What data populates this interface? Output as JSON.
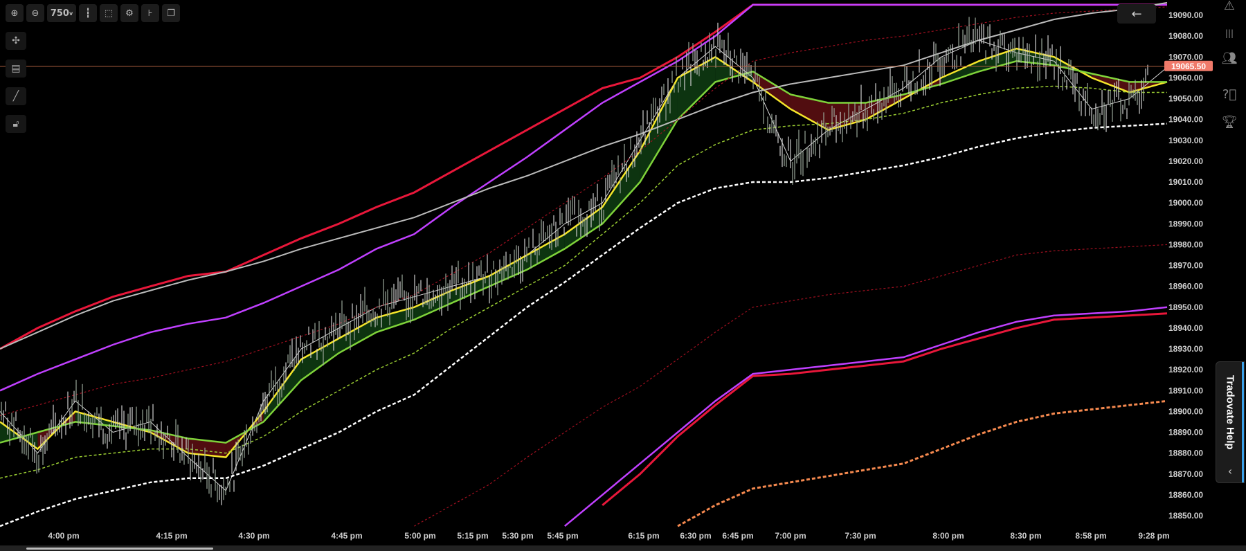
{
  "toolbar": {
    "zoom_in_icon": "zoom-in-icon",
    "zoom_out_icon": "zoom-out-icon",
    "bar_count_label": "750",
    "bar_count_suffix": "v"
  },
  "price_axis": {
    "labels": [
      "19090.00",
      "19080.00",
      "19070.00",
      "19060.00",
      "19050.00",
      "19040.00",
      "19030.00",
      "19020.00",
      "19010.00",
      "19000.00",
      "18990.00",
      "18980.00",
      "18970.00",
      "18960.00",
      "18950.00",
      "18940.00",
      "18930.00",
      "18920.00",
      "18910.00",
      "18900.00",
      "18890.00",
      "18880.00",
      "18870.00",
      "18860.00",
      "18850.00"
    ],
    "current_price": "19065.50",
    "current_price_color": "#f07a6a"
  },
  "time_axis": {
    "labels": [
      "4:00 pm",
      "4:15 pm",
      "4:30 pm",
      "4:45 pm",
      "5:00 pm",
      "5:15 pm",
      "5:30 pm",
      "5:45 pm",
      "6:15 pm",
      "6:30 pm",
      "6:45 pm",
      "7:00 pm",
      "7:30 pm",
      "8:00 pm",
      "8:30 pm",
      "8:58 pm",
      "9:28 pm"
    ]
  },
  "chart_data": {
    "type": "line",
    "ylim": [
      18845,
      19095
    ],
    "x": [
      "3:52 pm",
      "4:00 pm",
      "4:08 pm",
      "4:15 pm",
      "4:23 pm",
      "4:30 pm",
      "4:37 pm",
      "4:45 pm",
      "4:52 pm",
      "5:00 pm",
      "5:08 pm",
      "5:15 pm",
      "5:30 pm",
      "5:45 pm",
      "6:00 pm",
      "6:15 pm",
      "6:30 pm",
      "6:45 pm",
      "7:00 pm",
      "7:15 pm",
      "7:30 pm",
      "7:38 pm",
      "7:45 pm",
      "7:52 pm",
      "8:00 pm",
      "8:15 pm",
      "8:30 pm",
      "8:45 pm",
      "8:58 pm",
      "9:10 pm",
      "9:20 pm",
      "9:28 pm"
    ],
    "series": [
      {
        "color": "#d8d8d8",
        "values": [
          18900,
          18880,
          18905,
          18890,
          18895,
          18878,
          18862,
          18905,
          18930,
          18940,
          18950,
          18955,
          18960,
          18965,
          18975,
          18990,
          19000,
          19030,
          19060,
          19075,
          19060,
          19020,
          19035,
          19045,
          19055,
          19070,
          19078,
          19072,
          19068,
          19045,
          19050,
          19065
        ]
      },
      {
        "color": "#f5e62a",
        "values": [
          18895,
          18882,
          18900,
          18895,
          18890,
          18880,
          18878,
          18900,
          18925,
          18935,
          18945,
          18950,
          18958,
          18965,
          18975,
          18985,
          18998,
          19025,
          19060,
          19070,
          19058,
          19045,
          19035,
          19040,
          19050,
          19060,
          19068,
          19074,
          19070,
          19060,
          19053,
          19058
        ]
      },
      {
        "color": "#7fd33a",
        "values": [
          18885,
          18890,
          18895,
          18893,
          18891,
          18887,
          18885,
          18895,
          18915,
          18928,
          18938,
          18944,
          18952,
          18960,
          18968,
          18978,
          18990,
          19010,
          19040,
          19058,
          19063,
          19052,
          19048,
          19048,
          19052,
          19057,
          19063,
          19068,
          19066,
          19062,
          19058,
          19058
        ]
      },
      {
        "color": "#9acd32",
        "values": [
          18868,
          18872,
          18878,
          18880,
          18882,
          18882,
          18880,
          18888,
          18900,
          18910,
          18920,
          18928,
          18940,
          18950,
          18960,
          18970,
          18985,
          19000,
          19018,
          19028,
          19035,
          19037,
          19038,
          19040,
          19043,
          19048,
          19052,
          19055,
          19056,
          19055,
          19053,
          19053
        ]
      },
      {
        "color": "#ffffff",
        "values": [
          18845,
          18852,
          18858,
          18862,
          18866,
          18868,
          18868,
          18874,
          18882,
          18890,
          18900,
          18908,
          18922,
          18936,
          18950,
          18962,
          18975,
          18988,
          19000,
          19007,
          19010,
          19010,
          19012,
          19015,
          19018,
          19022,
          19027,
          19031,
          19034,
          19036,
          19037,
          19038
        ]
      },
      {
        "color": "#e8173a",
        "values": [
          18930,
          18940,
          18948,
          18955,
          18960,
          18965,
          18967,
          18975,
          18983,
          18990,
          18998,
          19005,
          19015,
          19025,
          19035,
          19045,
          19055,
          19060,
          19070,
          19082,
          19095,
          19095,
          19095,
          19095,
          19095,
          19095,
          19095,
          19095,
          19095,
          19095,
          19095,
          19095
        ]
      },
      {
        "color": "#c040ff",
        "values": [
          18910,
          18918,
          18925,
          18932,
          18938,
          18942,
          18945,
          18952,
          18960,
          18968,
          18978,
          18985,
          18998,
          19010,
          19022,
          19035,
          19048,
          19058,
          19068,
          19080,
          19095,
          19095,
          19095,
          19095,
          19095,
          19095,
          19095,
          19095,
          19095,
          19095,
          19095,
          19095
        ]
      },
      {
        "color": "#bbbbbb",
        "values": [
          18930,
          18938,
          18946,
          18953,
          18958,
          18963,
          18967,
          18972,
          18978,
          18983,
          18988,
          18993,
          19000,
          19007,
          19013,
          19020,
          19027,
          19033,
          19040,
          19047,
          19053,
          19057,
          19060,
          19063,
          19066,
          19072,
          19078,
          19083,
          19088,
          19091,
          19093,
          19096
        ]
      },
      {
        "color": "#a01020",
        "values": [
          18898,
          18903,
          18908,
          18913,
          18916,
          18920,
          18924,
          18930,
          18936,
          18942,
          18950,
          18956,
          18966,
          18976,
          18988,
          19000,
          19012,
          19025,
          19040,
          19055,
          19068,
          19072,
          19075,
          19078,
          19080,
          19083,
          19086,
          19089,
          19091,
          19092,
          19093,
          19094
        ]
      },
      {
        "color": "#a01020",
        "values": [
          null,
          null,
          null,
          null,
          null,
          null,
          null,
          null,
          null,
          null,
          null,
          18845,
          18855,
          18865,
          18878,
          18890,
          18902,
          18912,
          18925,
          18938,
          18950,
          18953,
          18956,
          18958,
          18960,
          18965,
          18970,
          18975,
          18977,
          18978,
          18979,
          18980
        ]
      },
      {
        "color": "#c040ff",
        "values": [
          null,
          null,
          null,
          null,
          null,
          null,
          null,
          null,
          null,
          null,
          null,
          null,
          null,
          null,
          null,
          18845,
          18860,
          18875,
          18890,
          18905,
          18918,
          18920,
          18922,
          18924,
          18926,
          18932,
          18938,
          18943,
          18946,
          18947,
          18948,
          18950
        ]
      },
      {
        "color": "#e8173a",
        "values": [
          null,
          null,
          null,
          null,
          null,
          null,
          null,
          null,
          null,
          null,
          null,
          null,
          null,
          null,
          null,
          null,
          18855,
          18870,
          18888,
          18903,
          18917,
          18918,
          18920,
          18922,
          18924,
          18930,
          18935,
          18940,
          18944,
          18945,
          18946,
          18947
        ]
      },
      {
        "color": "#f5894f",
        "values": [
          null,
          null,
          null,
          null,
          null,
          null,
          null,
          null,
          null,
          null,
          null,
          null,
          null,
          null,
          null,
          null,
          null,
          null,
          18845,
          18855,
          18863,
          18866,
          18869,
          18872,
          18875,
          18882,
          18889,
          18895,
          18899,
          18901,
          18903,
          18905
        ]
      }
    ]
  }
}
